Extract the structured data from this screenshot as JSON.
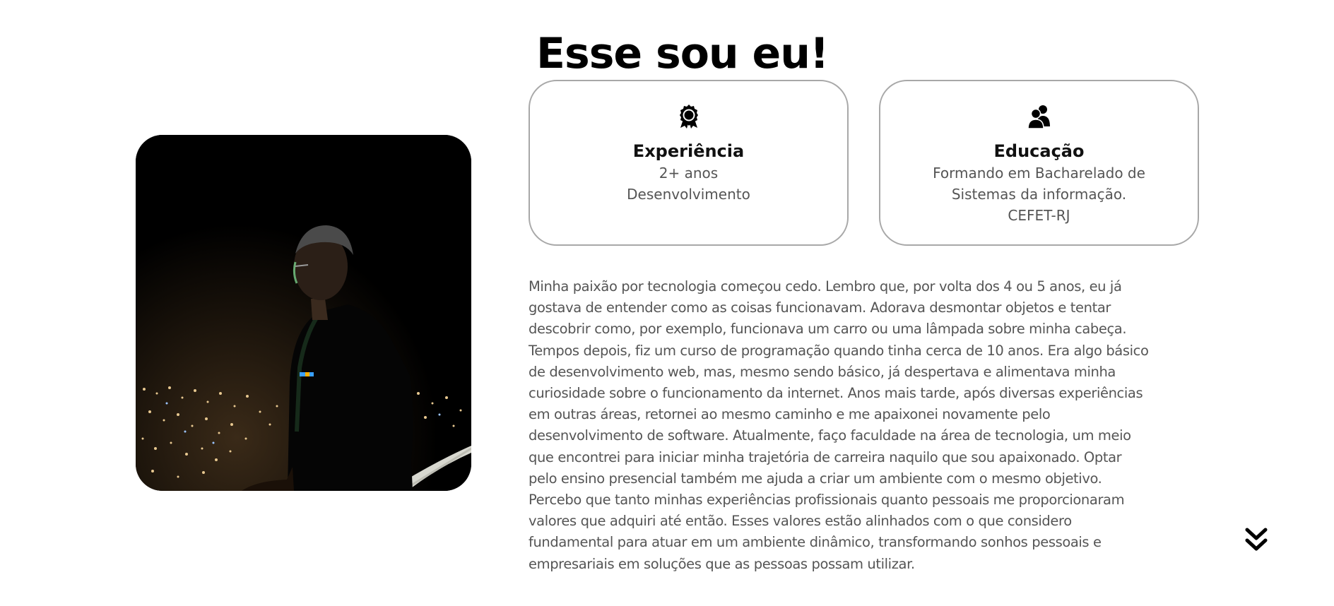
{
  "about": {
    "title": "Esse sou eu!",
    "cards": {
      "experience": {
        "icon": "award-icon",
        "title": "Experiência",
        "lines": [
          "2+ anos",
          "Desenvolvimento"
        ]
      },
      "education": {
        "icon": "users-icon",
        "title": "Educação",
        "lines": [
          "Formando em Bacharelado de",
          "Sistemas da informação.",
          "CEFET-RJ"
        ]
      }
    },
    "bio_lines": [
      "Minha paixão por tecnologia começou cedo. Lembro que, por volta dos 4 ou 5 anos, eu já",
      "gostava de entender como as coisas funcionavam. Adorava desmontar objetos e tentar",
      "descobrir como, por exemplo, funcionava um carro ou uma lâmpada sobre minha cabeça.",
      "Tempos depois, fiz um curso de programação quando tinha cerca de 10 anos. Era algo básico",
      "de desenvolvimento web, mas, mesmo sendo básico, já despertava e alimentava minha",
      "curiosidade sobre o funcionamento da internet. Anos mais tarde, após diversas experiências",
      "em outras áreas, retornei ao mesmo caminho e me apaixonei novamente pelo",
      "desenvolvimento de software. Atualmente, faço faculdade na área de tecnologia, um meio",
      "que encontrei para iniciar minha trajetória de carreira naquilo que sou apaixonado. Optar",
      "pelo ensino presencial também me ajuda a criar um ambiente com o mesmo objetivo.",
      "Percebo que tanto minhas experiências profissionais quanto pessoais me proporcionaram",
      "valores que adquiri até então. Esses valores estão alinhados com o que considero",
      "fundamental para atuar em um ambiente dinâmico, transformando sonhos pessoais e",
      "empresariais em soluções que as pessoas possam utilizar."
    ],
    "scroll_icon": "chevrons-down-icon"
  },
  "colors": {
    "title": "#000000",
    "text": "#555555",
    "card_border": "#a8a8a8",
    "background": "#ffffff"
  }
}
